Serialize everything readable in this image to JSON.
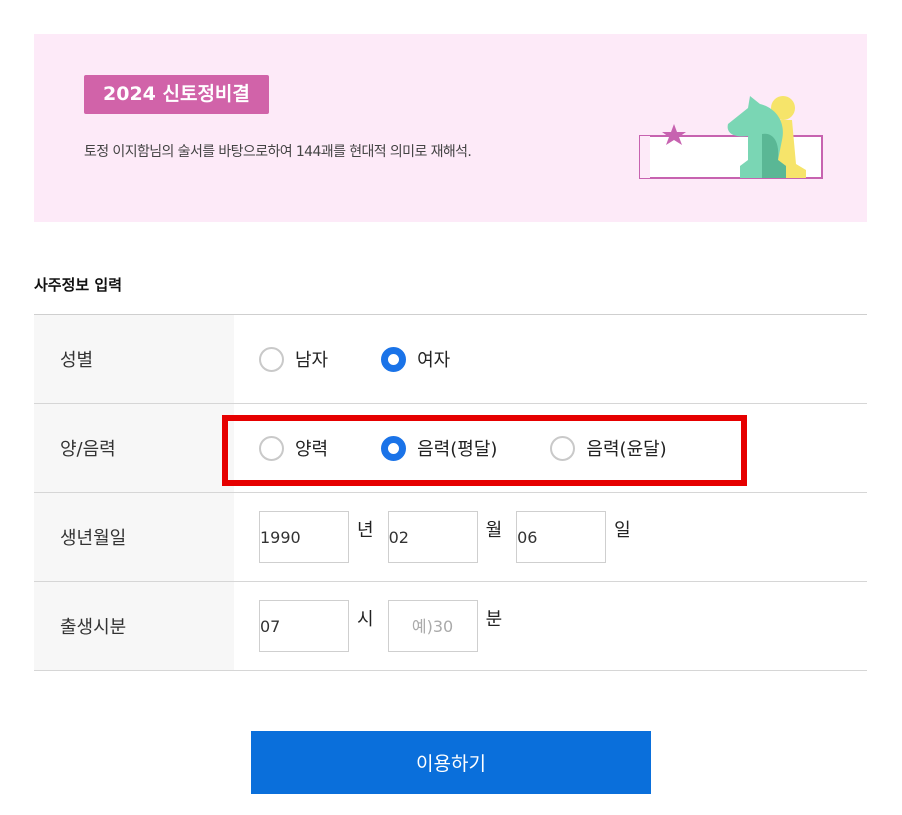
{
  "banner": {
    "badge": "2024 신토정비결",
    "description": "토정 이지함님의 술서를 바탕으로하여 144괘를 현대적 의미로 재해석."
  },
  "section_title": "사주정보 입력",
  "rows": {
    "gender": {
      "label": "성별",
      "options": [
        "남자",
        "여자"
      ],
      "selected": "여자"
    },
    "calendar": {
      "label": "양/음력",
      "options": [
        "양력",
        "음력(평달)",
        "음력(윤달)"
      ],
      "selected": "음력(평달)"
    },
    "birthdate": {
      "label": "생년월일",
      "year": "1990",
      "year_unit": "년",
      "month": "02",
      "month_unit": "월",
      "day": "06",
      "day_unit": "일"
    },
    "birthtime": {
      "label": "출생시분",
      "hour": "07",
      "hour_unit": "시",
      "minute": "",
      "minute_placeholder": "예)30",
      "minute_unit": "분"
    }
  },
  "submit_label": "이용하기",
  "colors": {
    "banner_bg": "#fdeaf8",
    "badge_bg": "#d163a9",
    "accent_blue": "#1a73e8",
    "button_bg": "#0a6fdb",
    "highlight_red": "#e60000"
  }
}
